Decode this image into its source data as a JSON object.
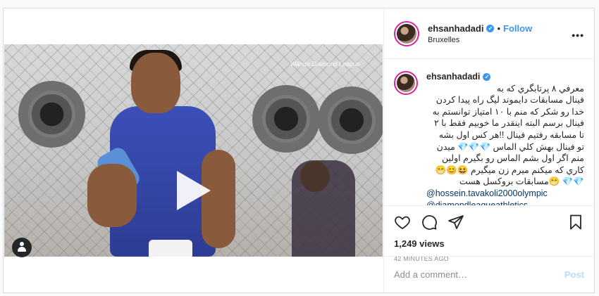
{
  "post": {
    "username": "ehsanhadadi",
    "follow_label": "Follow",
    "dot": "•",
    "location": "Bruxelles",
    "more_label": "•••",
    "verified_glyph": "✓",
    "video_logo": "Wanda Diamond League",
    "caption": "معرفي ٨ پرتابگري كه به\nفينال مسابقات دايموند ليگ راه پيدا كردن\nخدا رو شكر كه منم با ١٠ امتياز توانستم به\nفينال برسم البته اينقدر ما خوبيم فقط با ٢\nتا مسابقه رفتيم فينال !!هر كس اول بشه\nتو فينال بهش كلي الماس 💎💎💎 ميدن\nمنم اگر اول بشم الماس رو بگيرم اولين\nكاري كه ميكنم ميرم زن ميگيرم 😆😊😁\n💎💎 😁مسابقات بروكسل هست",
    "mentions": [
      "@hossein.tavakoli2000olympic",
      "@diamondleagueathletics"
    ],
    "views": "1,249 views",
    "time": "42 MINUTES AGO",
    "comment_placeholder": "Add a comment…",
    "post_label": "Post",
    "icons": [
      "heart-icon",
      "comment-icon",
      "share-icon",
      "bookmark-icon",
      "tag-user-icon",
      "play-icon",
      "more-options-icon",
      "verified-badge-icon"
    ]
  },
  "colors": {
    "link": "#3897f0",
    "mention": "#003569",
    "muted": "#8e8e8e",
    "post_disabled": "#b2dffc"
  }
}
